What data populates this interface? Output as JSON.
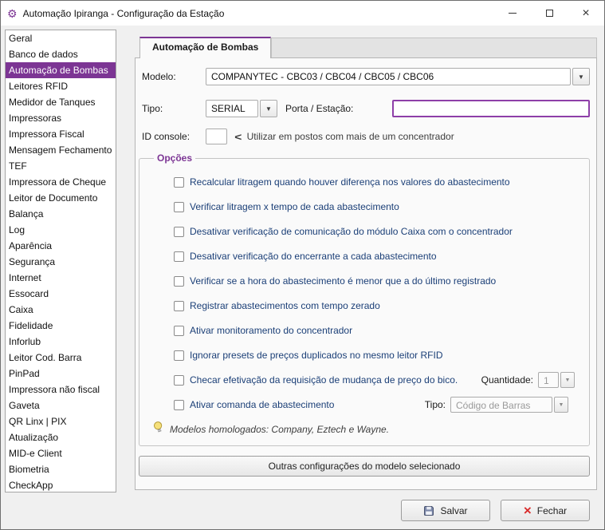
{
  "colors": {
    "accent": "#7C3594",
    "selected_item_bg": "#7C3594",
    "focus_border": "#8E3FA8",
    "option_text": "#1B3F77",
    "disabled_text": "#9A9A9A",
    "close_x_red": "#D92B2B"
  },
  "icons": {
    "app_icon": "⚙",
    "minimize_icon": "minimize-line",
    "maximize_icon": "maximize-square",
    "close_icon": "×",
    "combo_arrow_icon": "▼",
    "chevron_icon": "<",
    "bulb_icon": "lightbulb",
    "save_icon": "floppy-disk",
    "fechar_icon": "×"
  },
  "window": {
    "title": "Automação Ipiranga - Configuração da Estação"
  },
  "sidebar": {
    "items": [
      {
        "label": "Geral",
        "selected": false
      },
      {
        "label": "Banco de dados",
        "selected": false
      },
      {
        "label": "Automação de Bombas",
        "selected": true
      },
      {
        "label": "Leitores RFID",
        "selected": false
      },
      {
        "label": "Medidor de Tanques",
        "selected": false
      },
      {
        "label": "Impressoras",
        "selected": false
      },
      {
        "label": "Impressora Fiscal",
        "selected": false
      },
      {
        "label": "Mensagem Fechamento",
        "selected": false
      },
      {
        "label": "TEF",
        "selected": false
      },
      {
        "label": "Impressora de Cheque",
        "selected": false
      },
      {
        "label": "Leitor de Documento",
        "selected": false
      },
      {
        "label": "Balança",
        "selected": false
      },
      {
        "label": "Log",
        "selected": false
      },
      {
        "label": "Aparência",
        "selected": false
      },
      {
        "label": "Segurança",
        "selected": false
      },
      {
        "label": "Internet",
        "selected": false
      },
      {
        "label": "Essocard",
        "selected": false
      },
      {
        "label": "Caixa",
        "selected": false
      },
      {
        "label": "Fidelidade",
        "selected": false
      },
      {
        "label": "Inforlub",
        "selected": false
      },
      {
        "label": "Leitor Cod. Barra",
        "selected": false
      },
      {
        "label": "PinPad",
        "selected": false
      },
      {
        "label": "Impressora não fiscal",
        "selected": false
      },
      {
        "label": "Gaveta",
        "selected": false
      },
      {
        "label": "QR Linx | PIX",
        "selected": false
      },
      {
        "label": "Atualização",
        "selected": false
      },
      {
        "label": "MID-e Client",
        "selected": false
      },
      {
        "label": "Biometria",
        "selected": false
      },
      {
        "label": "CheckApp",
        "selected": false
      }
    ]
  },
  "tab": {
    "label": "Automação de Bombas"
  },
  "form": {
    "modelo": {
      "label": "Modelo:",
      "value": "COMPANYTEC - CBC03 / CBC04 / CBC05 / CBC06"
    },
    "tipo": {
      "label": "Tipo:",
      "value": "SERIAL"
    },
    "porta": {
      "label": "Porta / Estação:",
      "value": ""
    },
    "id_console": {
      "label": "ID console:",
      "value": "",
      "hint": "Utilizar em postos com mais de um concentrador"
    }
  },
  "opcoes": {
    "legend": "Opções",
    "checkboxes": [
      {
        "label": "Recalcular litragem quando houver diferença nos valores do abastecimento",
        "checked": false
      },
      {
        "label": "Verificar litragem x tempo de cada abastecimento",
        "checked": false
      },
      {
        "label": "Desativar verificação de comunicação do módulo Caixa com o concentrador",
        "checked": false
      },
      {
        "label": "Desativar verificação do encerrante a cada abastecimento",
        "checked": false
      },
      {
        "label": "Verificar se a hora do abastecimento é menor que a do último registrado",
        "checked": false
      },
      {
        "label": "Registrar abastecimentos com tempo zerado",
        "checked": false
      },
      {
        "label": "Ativar monitoramento do concentrador",
        "checked": false
      },
      {
        "label": "Ignorar presets de preços duplicados no mesmo leitor RFID",
        "checked": false
      },
      {
        "label": "Checar efetivação da requisição de mudança de preço do bico.",
        "checked": false,
        "extra": {
          "kind": "quantity",
          "name": "quantidade-combo",
          "label": "Quantidade:",
          "value": "1",
          "disabled": true
        }
      },
      {
        "label": "Ativar comanda de abastecimento",
        "checked": false,
        "extra": {
          "kind": "type",
          "name": "tipo-comanda-combo",
          "label": "Tipo:",
          "value": "Código de Barras",
          "disabled": true
        }
      }
    ],
    "hint": "Modelos homologados: Company, Eztech e Wayne."
  },
  "buttons": {
    "outras": "Outras configurações do modelo selecionado",
    "salvar": "Salvar",
    "fechar": "Fechar"
  }
}
